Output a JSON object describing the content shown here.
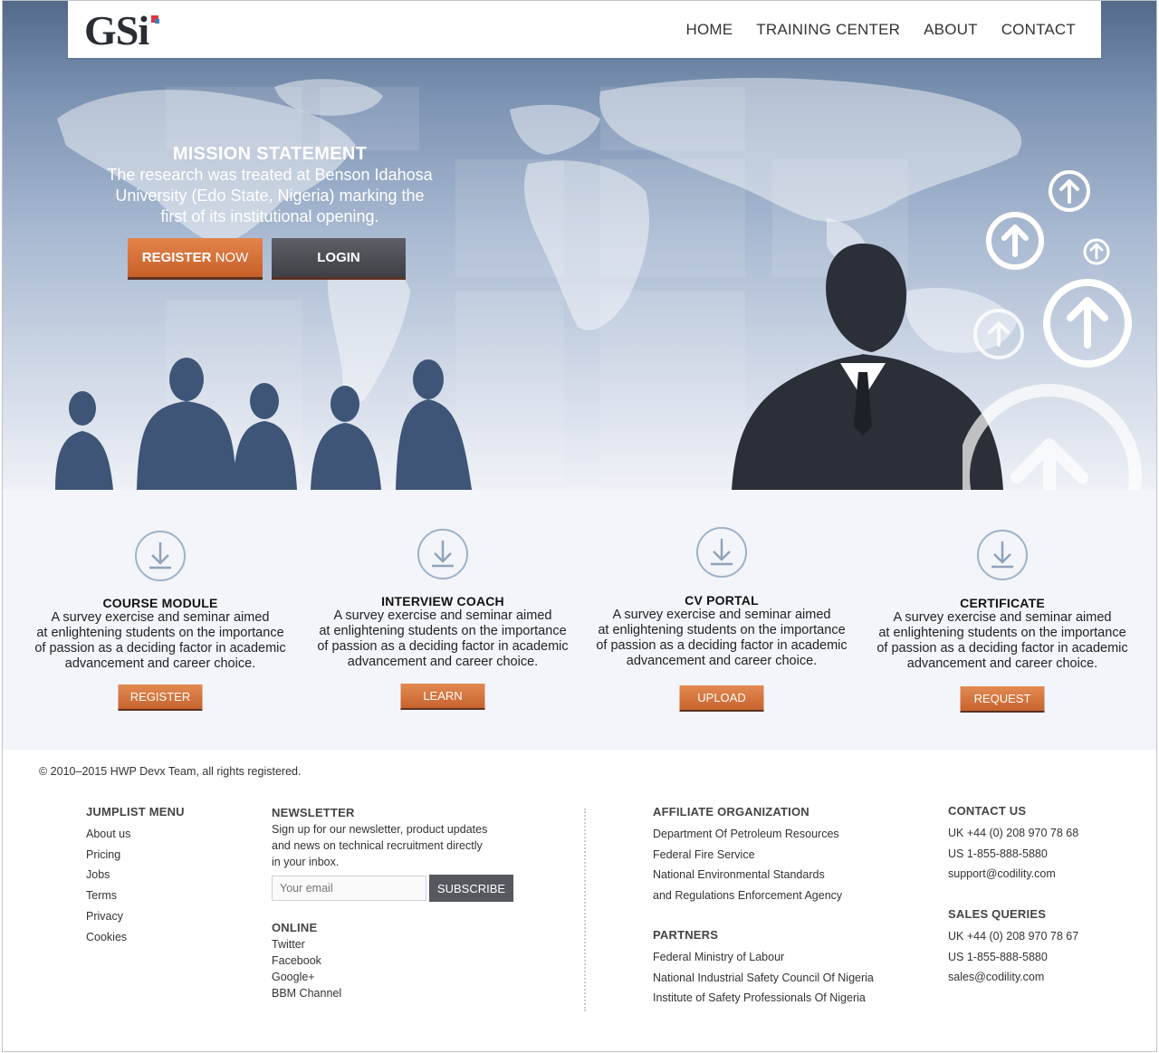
{
  "header": {
    "logo": "GSi",
    "nav": [
      "HOME",
      "TRAINING CENTER",
      "ABOUT",
      "CONTACT"
    ]
  },
  "hero": {
    "title": "MISSION STATEMENT",
    "line1": "The research was treated at Benson Idahosa",
    "line2": "University (Edo State, Nigeria) marking the",
    "line3": "first of its institutional opening.",
    "register_bold": "REGISTER",
    "register_rest": "NOW",
    "login": "LOGIN"
  },
  "features": [
    {
      "title": "COURSE MODULE",
      "l1": "A survey exercise and seminar aimed",
      "l2": "at enlightening students on the importance",
      "l3": "of passion as a deciding factor in academic",
      "l4": "advancement and career choice.",
      "button": "REGISTER"
    },
    {
      "title": "INTERVIEW COACH",
      "l1": "A survey exercise and seminar aimed",
      "l2": "at enlightening students on the importance",
      "l3": "of passion as a deciding factor in academic",
      "l4": "advancement and career choice.",
      "button": "LEARN"
    },
    {
      "title": "CV PORTAL",
      "l1": "A survey exercise and seminar aimed",
      "l2": "at enlightening students on the importance",
      "l3": "of passion as a deciding factor in academic",
      "l4": "advancement and career choice.",
      "button": "UPLOAD"
    },
    {
      "title": "CERTIFICATE",
      "l1": "A survey exercise and seminar aimed",
      "l2": "at enlightening students on the importance",
      "l3": "of passion as a deciding factor in academic",
      "l4": "advancement and career choice.",
      "button": "REQUEST"
    }
  ],
  "footer": {
    "copyright": "© 2010–2015 HWP Devx Team, all rights registered.",
    "jumplist": {
      "title": "JUMPLIST MENU",
      "items": [
        "About us",
        "Pricing",
        "Jobs",
        "Terms",
        "Privacy",
        "Cookies"
      ]
    },
    "newsletter": {
      "title": "NEWSLETTER",
      "l1": "Sign up for our newsletter, product updates",
      "l2": "and news on technical recruitment directly",
      "l3": "in your inbox.",
      "placeholder": "Your email",
      "button": "SUBSCRIBE"
    },
    "online": {
      "title": "ONLINE",
      "items": [
        "Twitter",
        "Facebook",
        "Google+",
        "BBM Channel"
      ]
    },
    "affiliate": {
      "title": "AFFILIATE ORGANIZATION",
      "items": [
        "Department Of Petroleum Resources",
        "Federal Fire Service",
        "National Environmental Standards",
        "and Regulations Enforcement Agency"
      ]
    },
    "partners": {
      "title": "PARTNERS",
      "items": [
        "Federal Ministry of Labour",
        "National Industrial Safety Council Of Nigeria",
        "Institute of Safety Professionals Of Nigeria"
      ]
    },
    "contact": {
      "title": "CONTACT US",
      "items": [
        "UK +44 (0) 208 970 78 68",
        "US 1-855-888-5880",
        "support@codility.com"
      ]
    },
    "sales": {
      "title": "SALES QUERIES",
      "items": [
        "UK +44 (0) 208 970 78 67",
        "US 1-855-888-5880",
        "sales@codility.com"
      ]
    }
  }
}
